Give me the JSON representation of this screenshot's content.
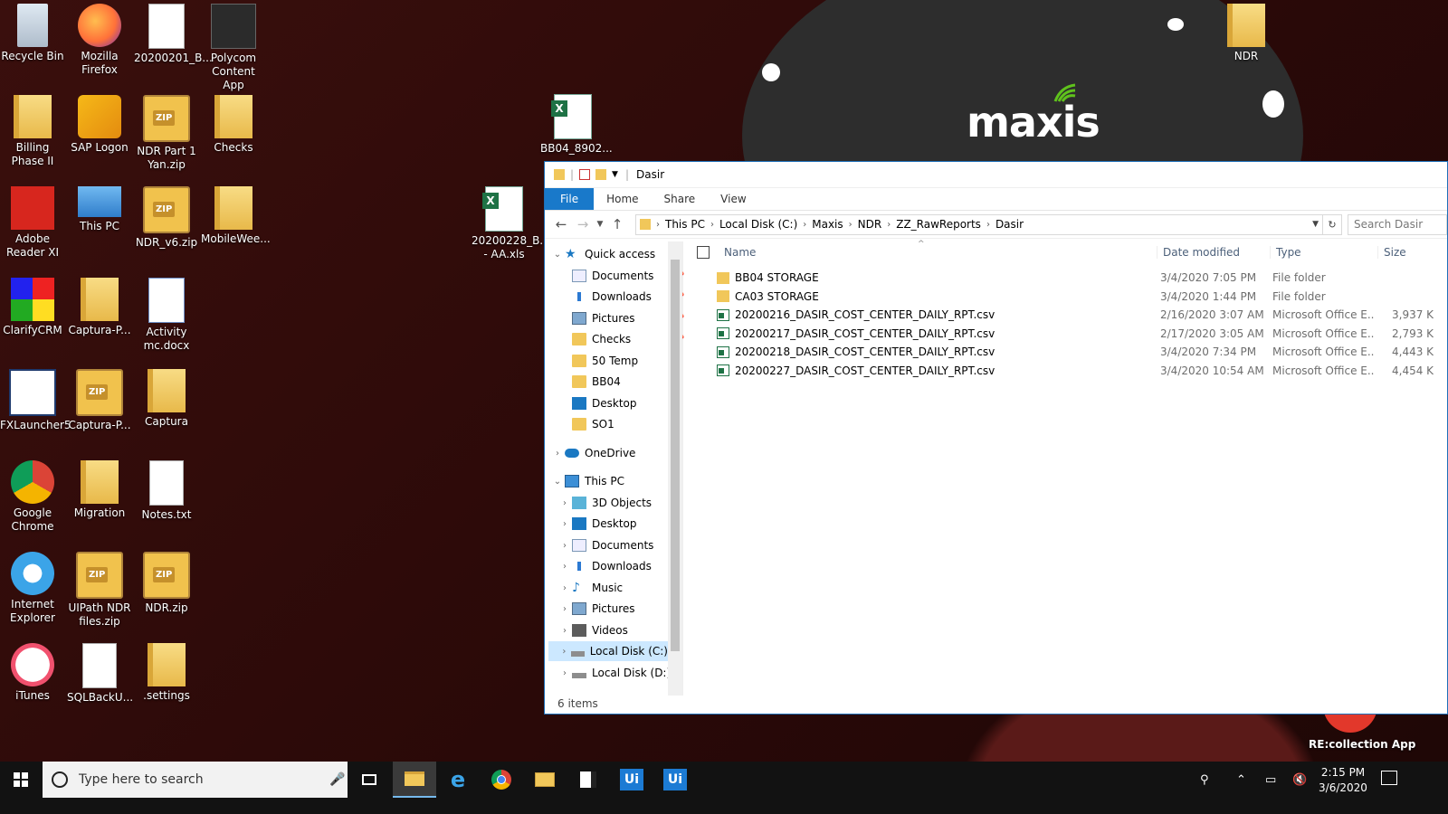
{
  "desktop": {
    "icons": [
      {
        "label": "Recycle Bin",
        "icon": "recycle-bin-icon"
      },
      {
        "label": "Mozilla Firefox",
        "icon": "firefox-icon"
      },
      {
        "label": "20200201_B...",
        "icon": "document-icon"
      },
      {
        "label": "Polycom Content App",
        "icon": "polycom-icon"
      },
      {
        "label": "Billing Phase II",
        "icon": "folder-icon"
      },
      {
        "label": "SAP Logon",
        "icon": "sap-icon"
      },
      {
        "label": "NDR Part 1 Yan.zip",
        "icon": "zip-icon"
      },
      {
        "label": "Checks",
        "icon": "folder-icon"
      },
      {
        "label": "Adobe Reader XI",
        "icon": "adobe-reader-icon"
      },
      {
        "label": "This PC",
        "icon": "this-pc-icon"
      },
      {
        "label": "NDR_v6.zip",
        "icon": "zip-icon"
      },
      {
        "label": "MobileWee...",
        "icon": "folder-icon"
      },
      {
        "label": "ClarifyCRM",
        "icon": "clarifycrm-icon"
      },
      {
        "label": "Captura-P...",
        "icon": "folder-icon"
      },
      {
        "label": "Activity mc.docx",
        "icon": "word-document-icon"
      },
      {
        "label": "FXLauncher5",
        "icon": "fxlauncher-icon"
      },
      {
        "label": "Captura-P...",
        "icon": "zip-icon"
      },
      {
        "label": "Captura",
        "icon": "folder-icon"
      },
      {
        "label": "Google Chrome",
        "icon": "chrome-icon"
      },
      {
        "label": "Migration",
        "icon": "folder-icon"
      },
      {
        "label": "Notes.txt",
        "icon": "text-file-icon"
      },
      {
        "label": "Internet Explorer",
        "icon": "internet-explorer-icon"
      },
      {
        "label": "UIPath NDR files.zip",
        "icon": "zip-icon"
      },
      {
        "label": "NDR.zip",
        "icon": "zip-icon"
      },
      {
        "label": "iTunes",
        "icon": "itunes-icon"
      },
      {
        "label": "SQLBackU...",
        "icon": "text-file-icon"
      },
      {
        "label": ".settings",
        "icon": "folder-icon"
      },
      {
        "label": "BB04_8902...",
        "icon": "excel-icon"
      },
      {
        "label": "20200228_B... - AA.xls",
        "icon": "excel-icon"
      },
      {
        "label": "NDR",
        "icon": "folder-icon"
      }
    ],
    "wallpaper_logo": "maxis",
    "recollection_label": "RE:collection App"
  },
  "explorer": {
    "title": "Dasir",
    "ribbon_tabs": [
      "File",
      "Home",
      "Share",
      "View"
    ],
    "breadcrumb": [
      "This PC",
      "Local Disk (C:)",
      "Maxis",
      "NDR",
      "ZZ_RawReports",
      "Dasir"
    ],
    "search_placeholder": "Search Dasir",
    "nav": {
      "quick_access": "Quick access",
      "pinned": [
        "Documents",
        "Downloads",
        "Pictures",
        "Checks"
      ],
      "recent": [
        "50 Temp",
        "BB04",
        "Desktop",
        "SO1"
      ],
      "onedrive": "OneDrive",
      "this_pc": "This PC",
      "this_pc_items": [
        "3D Objects",
        "Desktop",
        "Documents",
        "Downloads",
        "Music",
        "Pictures",
        "Videos",
        "Local Disk (C:)",
        "Local Disk (D:)"
      ]
    },
    "columns": {
      "name": "Name",
      "date": "Date modified",
      "type": "Type",
      "size": "Size"
    },
    "files": [
      {
        "name": "BB04 STORAGE",
        "date": "3/4/2020 7:05 PM",
        "type": "File folder",
        "size": "",
        "kind": "folder"
      },
      {
        "name": "CA03 STORAGE",
        "date": "3/4/2020 1:44 PM",
        "type": "File folder",
        "size": "",
        "kind": "folder"
      },
      {
        "name": "20200216_DASIR_COST_CENTER_DAILY_RPT.csv",
        "date": "2/16/2020 3:07 AM",
        "type": "Microsoft Office E...",
        "size": "3,937 K",
        "kind": "csv"
      },
      {
        "name": "20200217_DASIR_COST_CENTER_DAILY_RPT.csv",
        "date": "2/17/2020 3:05 AM",
        "type": "Microsoft Office E...",
        "size": "2,793 K",
        "kind": "csv"
      },
      {
        "name": "20200218_DASIR_COST_CENTER_DAILY_RPT.csv",
        "date": "3/4/2020 7:34 PM",
        "type": "Microsoft Office E...",
        "size": "4,443 K",
        "kind": "csv"
      },
      {
        "name": "20200227_DASIR_COST_CENTER_DAILY_RPT.csv",
        "date": "3/4/2020 10:54 AM",
        "type": "Microsoft Office E...",
        "size": "4,454 K",
        "kind": "csv"
      }
    ],
    "status": "6 items"
  },
  "taskbar": {
    "search_placeholder": "Type here to search",
    "time": "2:15 PM",
    "date": "3/6/2020"
  }
}
